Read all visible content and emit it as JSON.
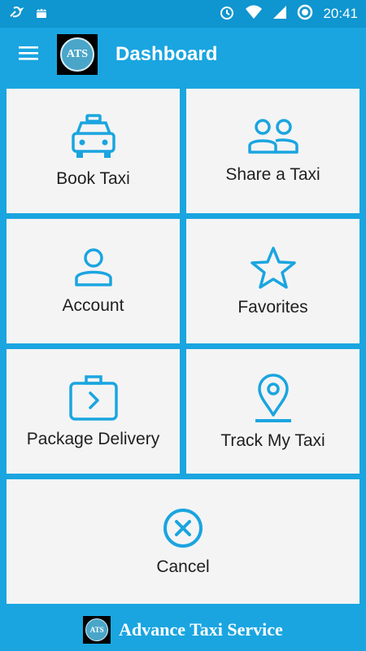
{
  "status_bar": {
    "time": "20:41",
    "icons": [
      "notification-icon",
      "android-icon",
      "alarm-icon",
      "wifi-icon",
      "signal-icon",
      "battery-icon"
    ]
  },
  "app_bar": {
    "menu_icon": "hamburger-menu-icon",
    "logo_text": "ATS",
    "title": "Dashboard"
  },
  "tiles": [
    {
      "label": "Book Taxi",
      "icon": "taxi-icon"
    },
    {
      "label": "Share a Taxi",
      "icon": "people-icon"
    },
    {
      "label": "Account",
      "icon": "person-icon"
    },
    {
      "label": "Favorites",
      "icon": "star-icon"
    },
    {
      "label": "Package Delivery",
      "icon": "briefcase-icon"
    },
    {
      "label": "Track My Taxi",
      "icon": "location-pin-icon"
    },
    {
      "label": "Cancel",
      "icon": "cancel-icon"
    }
  ],
  "footer": {
    "logo_text": "ATS",
    "brand": "Advance Taxi Service"
  },
  "colors": {
    "primary": "#1aa5e0",
    "status_bar": "#0f95cf",
    "tile_bg": "#f4f4f4",
    "icon": "#1aa5e0"
  }
}
